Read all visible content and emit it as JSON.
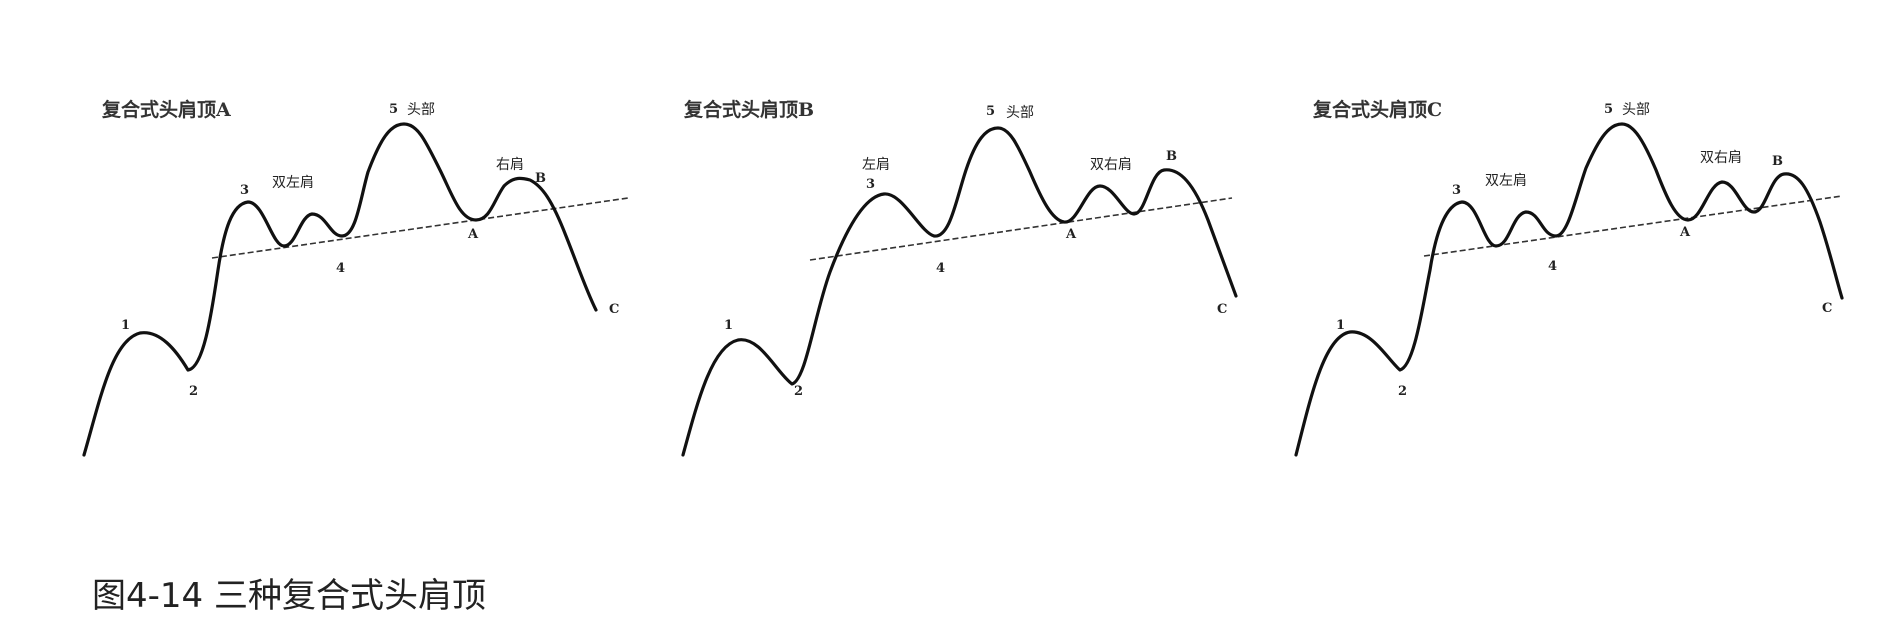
{
  "caption": "图4-14 三种复合式头肩顶",
  "colors": {
    "line": "#111111",
    "neckline": "#333333",
    "text": "#222222"
  },
  "panels": [
    {
      "title": "复合式头肩顶A",
      "labels": {
        "p1": "1",
        "p2": "2",
        "p3": "3",
        "p4": "4",
        "p5": "5",
        "head": "头部",
        "left_shoulder": "双左肩",
        "right_shoulder": "右肩",
        "pA": "A",
        "pB": "B",
        "pC": "C"
      }
    },
    {
      "title": "复合式头肩顶B",
      "labels": {
        "p1": "1",
        "p2": "2",
        "p3": "3",
        "p4": "4",
        "p5": "5",
        "head": "头部",
        "left_shoulder": "左肩",
        "right_shoulder": "双右肩",
        "pA": "A",
        "pB": "B",
        "pC": "C"
      }
    },
    {
      "title": "复合式头肩顶C",
      "labels": {
        "p1": "1",
        "p2": "2",
        "p3": "3",
        "p4": "4",
        "p5": "5",
        "head": "头部",
        "left_shoulder": "双左肩",
        "right_shoulder": "双右肩",
        "pA": "A",
        "pB": "B",
        "pC": "C"
      }
    }
  ]
}
